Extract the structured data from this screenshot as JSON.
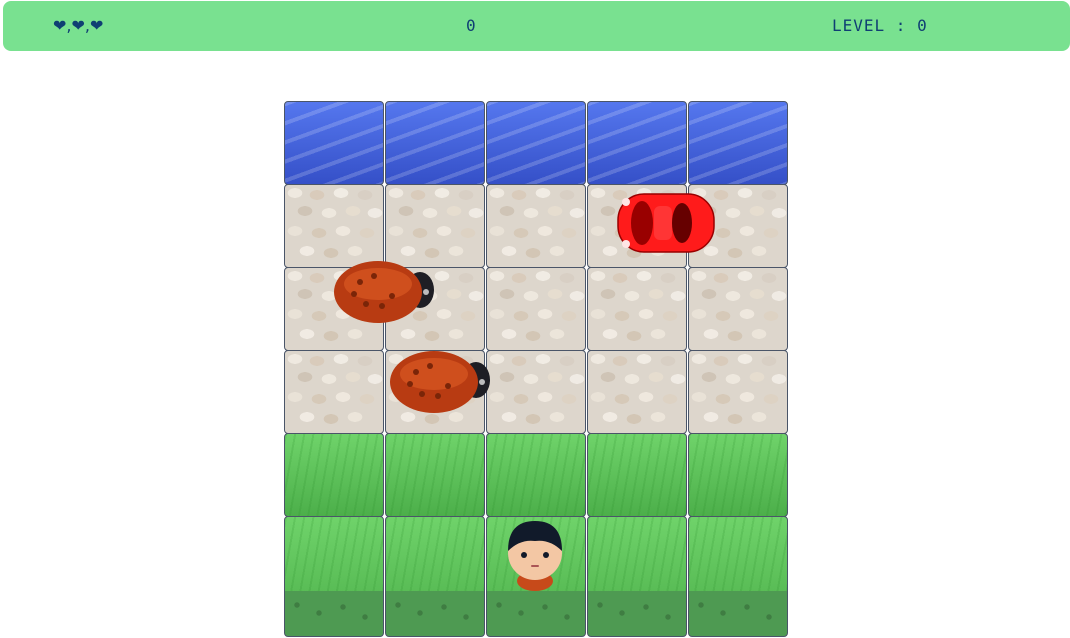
{
  "hud": {
    "lives": "❤,❤,❤",
    "score": "0",
    "level": "LEVEL : 0"
  },
  "board": {
    "rows": [
      "water",
      "stone",
      "stone",
      "stone",
      "grass",
      "grass"
    ],
    "columns": 5
  },
  "colors": {
    "hud_background": "#79e190",
    "hud_text": "#0f3f73",
    "car": "#ee1111",
    "bug": "#c0441a",
    "water": "#3f5fe0",
    "grass": "#5cc25a"
  },
  "sprites": [
    "car",
    "ladybug",
    "ladybug",
    "player"
  ]
}
